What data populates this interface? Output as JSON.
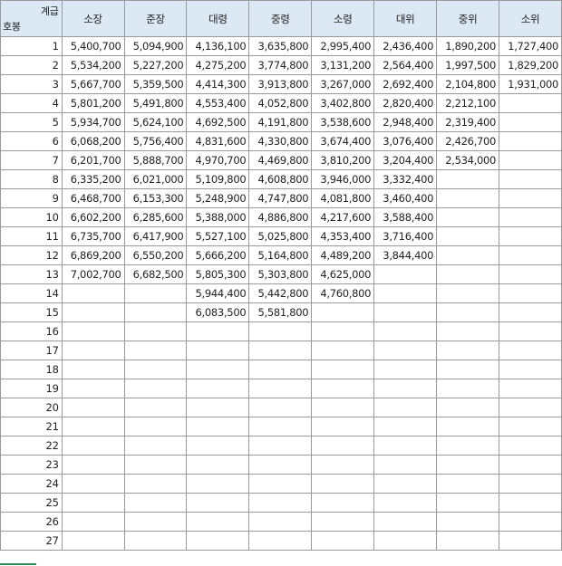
{
  "corner": {
    "top_label": "계급",
    "bottom_label": "호봉"
  },
  "columns": [
    "소장",
    "준장",
    "대령",
    "중령",
    "소령",
    "대위",
    "중위",
    "소위"
  ],
  "rows": [
    {
      "step": "1",
      "values": [
        "5,400,700",
        "5,094,900",
        "4,136,100",
        "3,635,800",
        "2,995,400",
        "2,436,400",
        "1,890,200",
        "1,727,400"
      ]
    },
    {
      "step": "2",
      "values": [
        "5,534,200",
        "5,227,200",
        "4,275,200",
        "3,774,800",
        "3,131,200",
        "2,564,400",
        "1,997,500",
        "1,829,200"
      ]
    },
    {
      "step": "3",
      "values": [
        "5,667,700",
        "5,359,500",
        "4,414,300",
        "3,913,800",
        "3,267,000",
        "2,692,400",
        "2,104,800",
        "1,931,000"
      ]
    },
    {
      "step": "4",
      "values": [
        "5,801,200",
        "5,491,800",
        "4,553,400",
        "4,052,800",
        "3,402,800",
        "2,820,400",
        "2,212,100",
        ""
      ]
    },
    {
      "step": "5",
      "values": [
        "5,934,700",
        "5,624,100",
        "4,692,500",
        "4,191,800",
        "3,538,600",
        "2,948,400",
        "2,319,400",
        ""
      ]
    },
    {
      "step": "6",
      "values": [
        "6,068,200",
        "5,756,400",
        "4,831,600",
        "4,330,800",
        "3,674,400",
        "3,076,400",
        "2,426,700",
        ""
      ]
    },
    {
      "step": "7",
      "values": [
        "6,201,700",
        "5,888,700",
        "4,970,700",
        "4,469,800",
        "3,810,200",
        "3,204,400",
        "2,534,000",
        ""
      ]
    },
    {
      "step": "8",
      "values": [
        "6,335,200",
        "6,021,000",
        "5,109,800",
        "4,608,800",
        "3,946,000",
        "3,332,400",
        "",
        ""
      ]
    },
    {
      "step": "9",
      "values": [
        "6,468,700",
        "6,153,300",
        "5,248,900",
        "4,747,800",
        "4,081,800",
        "3,460,400",
        "",
        ""
      ]
    },
    {
      "step": "10",
      "values": [
        "6,602,200",
        "6,285,600",
        "5,388,000",
        "4,886,800",
        "4,217,600",
        "3,588,400",
        "",
        ""
      ]
    },
    {
      "step": "11",
      "values": [
        "6,735,700",
        "6,417,900",
        "5,527,100",
        "5,025,800",
        "4,353,400",
        "3,716,400",
        "",
        ""
      ]
    },
    {
      "step": "12",
      "values": [
        "6,869,200",
        "6,550,200",
        "5,666,200",
        "5,164,800",
        "4,489,200",
        "3,844,400",
        "",
        ""
      ]
    },
    {
      "step": "13",
      "values": [
        "7,002,700",
        "6,682,500",
        "5,805,300",
        "5,303,800",
        "4,625,000",
        "",
        "",
        ""
      ]
    },
    {
      "step": "14",
      "values": [
        "",
        "",
        "5,944,400",
        "5,442,800",
        "4,760,800",
        "",
        "",
        ""
      ]
    },
    {
      "step": "15",
      "values": [
        "",
        "",
        "6,083,500",
        "5,581,800",
        "",
        "",
        "",
        ""
      ]
    },
    {
      "step": "16",
      "values": [
        "",
        "",
        "",
        "",
        "",
        "",
        "",
        ""
      ]
    },
    {
      "step": "17",
      "values": [
        "",
        "",
        "",
        "",
        "",
        "",
        "",
        ""
      ]
    },
    {
      "step": "18",
      "values": [
        "",
        "",
        "",
        "",
        "",
        "",
        "",
        ""
      ]
    },
    {
      "step": "19",
      "values": [
        "",
        "",
        "",
        "",
        "",
        "",
        "",
        ""
      ]
    },
    {
      "step": "20",
      "values": [
        "",
        "",
        "",
        "",
        "",
        "",
        "",
        ""
      ]
    },
    {
      "step": "21",
      "values": [
        "",
        "",
        "",
        "",
        "",
        "",
        "",
        ""
      ]
    },
    {
      "step": "22",
      "values": [
        "",
        "",
        "",
        "",
        "",
        "",
        "",
        ""
      ]
    },
    {
      "step": "23",
      "values": [
        "",
        "",
        "",
        "",
        "",
        "",
        "",
        ""
      ]
    },
    {
      "step": "24",
      "values": [
        "",
        "",
        "",
        "",
        "",
        "",
        "",
        ""
      ]
    },
    {
      "step": "25",
      "values": [
        "",
        "",
        "",
        "",
        "",
        "",
        "",
        ""
      ]
    },
    {
      "step": "26",
      "values": [
        "",
        "",
        "",
        "",
        "",
        "",
        "",
        ""
      ]
    },
    {
      "step": "27",
      "values": [
        "",
        "",
        "",
        "",
        "",
        "",
        "",
        ""
      ]
    }
  ],
  "colors": {
    "header_bg": "#dde8f5",
    "grid": "#9a9a9a"
  }
}
